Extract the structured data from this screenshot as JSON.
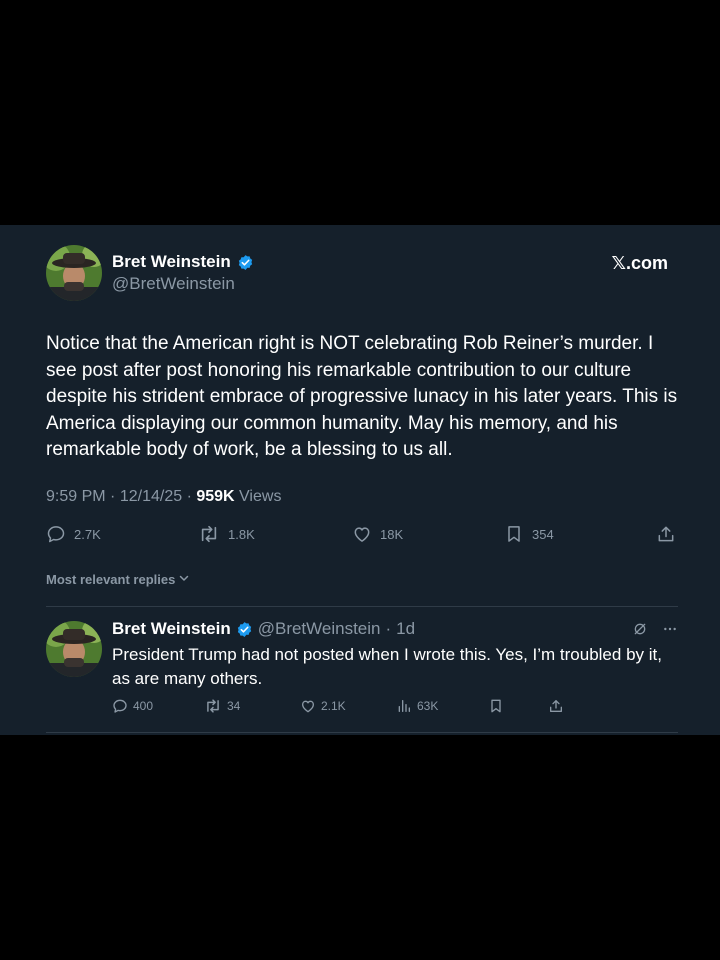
{
  "post": {
    "author_name": "Bret Weinstein",
    "author_handle": "@BretWeinstein",
    "source": "𝕏.com",
    "text": "Notice that the American right is NOT celebrating Rob Reiner’s murder. I see post after post honoring his remarkable contribution to our culture despite his strident embrace of progressive lunacy in his later years. This is America displaying our common humanity. May his memory, and his remarkable body of work, be a blessing to us all.",
    "time": "9:59 PM",
    "date": "12/14/25",
    "views_count": "959K",
    "views_label": "Views",
    "replies": "2.7K",
    "reposts": "1.8K",
    "likes": "18K",
    "bookmarks": "354"
  },
  "replies_section": {
    "sort_label": "Most relevant replies"
  },
  "reply": {
    "author_name": "Bret Weinstein",
    "author_handle": "@BretWeinstein",
    "age": "1d",
    "text": "President Trump had not posted when I wrote this. Yes, I’m troubled by it, as are many others.",
    "replies": "400",
    "reposts": "34",
    "likes": "2.1K",
    "views": "63K"
  },
  "colors": {
    "background": "#000000",
    "card": "#15202b",
    "text_primary": "#ffffff",
    "text_secondary": "#8b98a5",
    "verified_blue": "#1d9bf0"
  }
}
